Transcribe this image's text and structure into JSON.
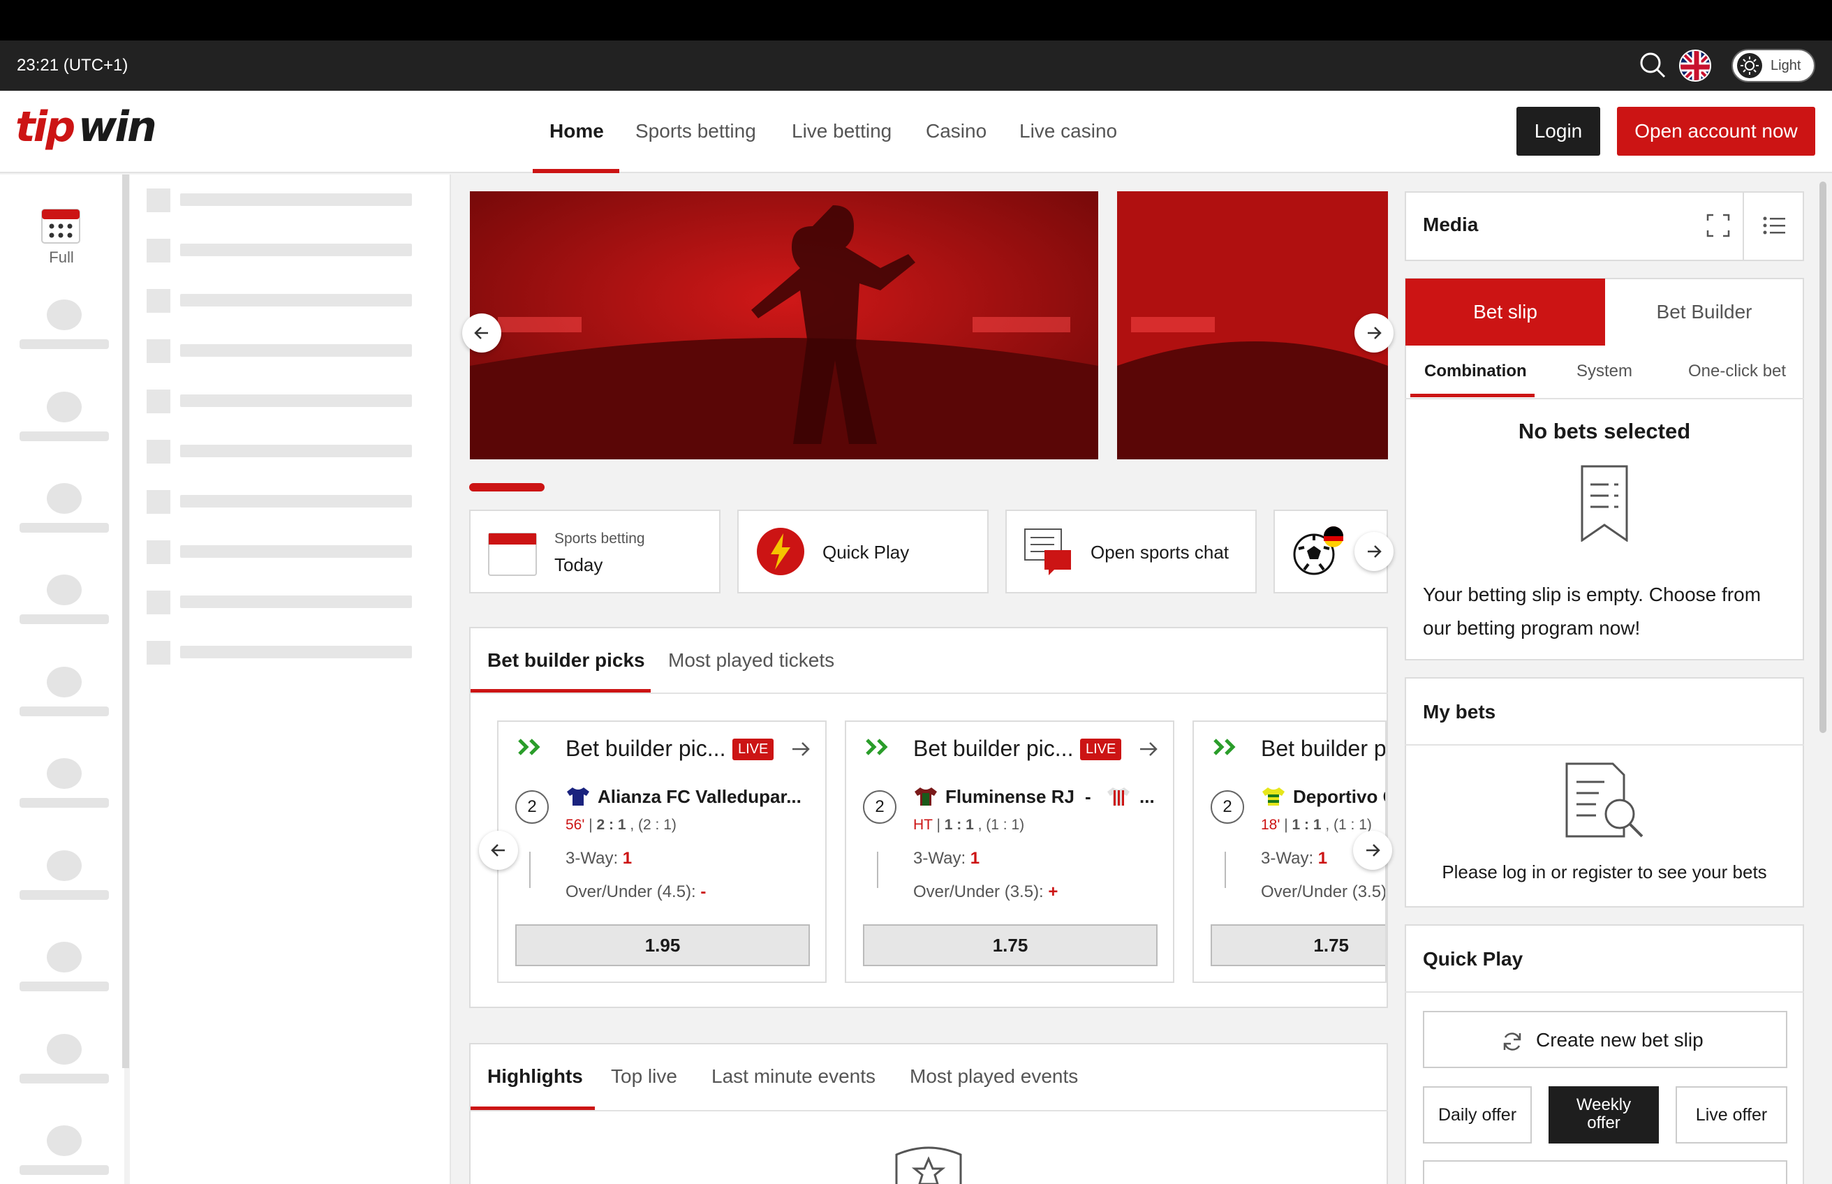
{
  "status_bar": {
    "time": "23:21 (UTC+1)",
    "theme_label": "Light"
  },
  "header": {
    "logo_text": "tipwin",
    "nav": [
      {
        "label": "Home"
      },
      {
        "label": "Sports betting"
      },
      {
        "label": "Live betting"
      },
      {
        "label": "Casino"
      },
      {
        "label": "Live casino"
      }
    ],
    "login": "Login",
    "open_account": "Open account now"
  },
  "left_rail": {
    "full_label": "Full"
  },
  "quick_links": {
    "sports_small": "Sports betting",
    "sports_main": "Today",
    "quick_play": "Quick Play",
    "chat": "Open sports chat"
  },
  "picks": {
    "tabs": [
      "Bet builder picks",
      "Most played tickets"
    ],
    "cards": [
      {
        "title": "Bet builder pic...",
        "live": "LIVE",
        "count": "2",
        "team": "Alianza FC Valledupar...",
        "time": "56'",
        "score": "2 : 1",
        "half": ", (2 : 1)",
        "line1": "3-Way:",
        "val1": "1",
        "line2": "Over/Under (4.5):",
        "val2": "-",
        "odd": "1.95",
        "shirt": "#1a237e"
      },
      {
        "title": "Bet builder pic...",
        "live": "LIVE",
        "count": "2",
        "team": "Fluminense RJ",
        "sep": "-",
        "ellipsis": "...",
        "time": "HT",
        "score": "1 : 1",
        "half": ", (1 : 1)",
        "line1": "3-Way:",
        "val1": "1",
        "line2": "Over/Under (3.5):",
        "val2": "+",
        "odd": "1.75",
        "shirt": "#7a1a1a"
      },
      {
        "title": "Bet builder p",
        "count": "2",
        "team": "Deportivo G",
        "time": "18'",
        "score": "1 : 1",
        "half": ", (1 : 1)",
        "line1": "3-Way:",
        "val1": "1",
        "line2": "Over/Under (3.5)",
        "odd": "1.75",
        "shirt": "#e6e61a"
      }
    ]
  },
  "events": {
    "tabs": [
      "Highlights",
      "Top live",
      "Last minute events",
      "Most played events"
    ]
  },
  "right": {
    "media_title": "Media",
    "betslip_tabs": [
      "Bet slip",
      "Bet Builder"
    ],
    "slip_types": [
      "Combination",
      "System",
      "One-click bet"
    ],
    "no_bets": "No bets selected",
    "empty_msg_1": "Your betting slip is empty. Choose from",
    "empty_msg_2": "our betting program now!",
    "my_bets_title": "My bets",
    "my_bets_msg": "Please log in or register to see your bets",
    "quick_play_title": "Quick Play",
    "create_slip": "Create new bet slip",
    "offers": [
      "Daily offer",
      "Weekly offer",
      "Live offer"
    ]
  },
  "colors": {
    "accent": "#cc1414",
    "dark": "#1e1e1e"
  }
}
